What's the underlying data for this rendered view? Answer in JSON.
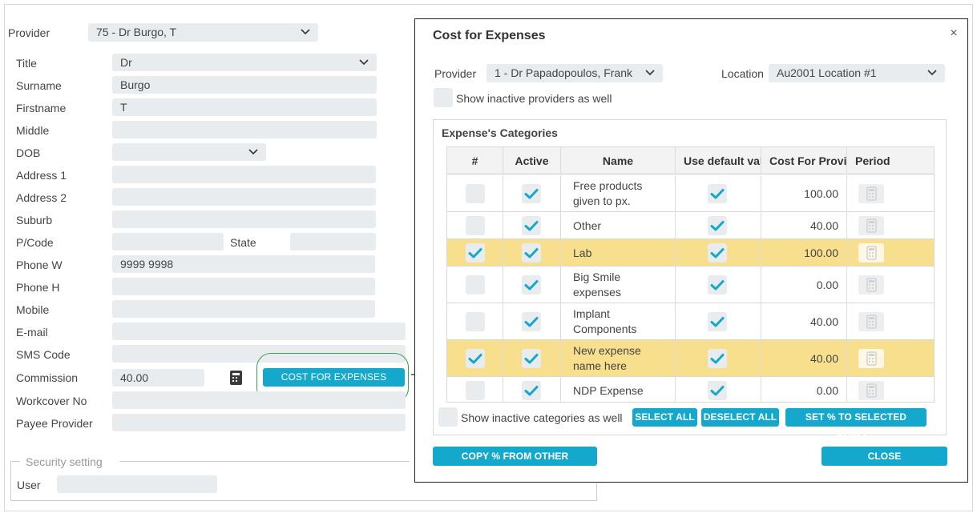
{
  "left_form": {
    "provider": {
      "label": "Provider",
      "value": "75 - Dr Burgo, T"
    },
    "title": {
      "label": "Title",
      "value": "Dr"
    },
    "surname": {
      "label": "Surname",
      "value": "Burgo"
    },
    "firstname": {
      "label": "Firstname",
      "value": "T"
    },
    "middle": {
      "label": "Middle",
      "value": ""
    },
    "dob": {
      "label": "DOB",
      "value": ""
    },
    "address1": {
      "label": "Address 1",
      "value": ""
    },
    "address2": {
      "label": "Address 2",
      "value": ""
    },
    "suburb": {
      "label": "Suburb",
      "value": ""
    },
    "pcode": {
      "label": "P/Code",
      "value": ""
    },
    "state": {
      "label": "State",
      "value": ""
    },
    "phone_w": {
      "label": "Phone W",
      "value": "9999 9998"
    },
    "phone_h": {
      "label": "Phone H",
      "value": ""
    },
    "mobile": {
      "label": "Mobile",
      "value": ""
    },
    "email": {
      "label": "E-mail",
      "value": ""
    },
    "sms_code": {
      "label": "SMS Code",
      "value": ""
    },
    "commission": {
      "label": "Commission",
      "value": "40.00"
    },
    "cost_button": "COST FOR EXPENSES",
    "workcover": {
      "label": "Workcover No",
      "value": ""
    },
    "payee": {
      "label": "Payee Provider",
      "value": ""
    },
    "security_legend": "Security setting",
    "user": {
      "label": "User",
      "value": ""
    }
  },
  "dialog": {
    "title": "Cost for Expenses",
    "close": "×",
    "provider": {
      "label": "Provider",
      "value": "1 - Dr Papadopoulos, Frank"
    },
    "location": {
      "label": "Location",
      "value": "Au2001 Location #1"
    },
    "show_inactive_providers": "Show inactive providers as well",
    "categories_title": "Expense's Categories",
    "columns": [
      "#",
      "Active",
      "Name",
      "Use default value",
      "Cost For Provider",
      "Period"
    ],
    "rows": [
      {
        "selected": false,
        "active": true,
        "name": [
          "Free products",
          "given to px."
        ],
        "use_default": true,
        "cost": "100.00",
        "highlight": false
      },
      {
        "selected": false,
        "active": true,
        "name": [
          "Other"
        ],
        "use_default": true,
        "cost": "40.00",
        "highlight": false
      },
      {
        "selected": true,
        "active": true,
        "name": [
          "Lab"
        ],
        "use_default": true,
        "cost": "100.00",
        "highlight": true
      },
      {
        "selected": false,
        "active": true,
        "name": [
          "Big Smile",
          "expenses"
        ],
        "use_default": true,
        "cost": "0.00",
        "highlight": false
      },
      {
        "selected": false,
        "active": true,
        "name": [
          "Implant",
          "Components"
        ],
        "use_default": true,
        "cost": "40.00",
        "highlight": false
      },
      {
        "selected": true,
        "active": true,
        "name": [
          "New expense",
          "name here"
        ],
        "use_default": true,
        "cost": "40.00",
        "highlight": true
      },
      {
        "selected": false,
        "active": true,
        "name": [
          "NDP Expense"
        ],
        "use_default": true,
        "cost": "0.00",
        "highlight": false
      }
    ],
    "show_inactive_categories": "Show inactive categories as well",
    "select_all": "SELECT ALL",
    "deselect_all": "DESELECT ALL",
    "set_percent": "SET % TO SELECTED ROWS...",
    "copy_percent": "COPY % FROM OTHER PROVIDER...",
    "close_button": "CLOSE"
  },
  "colors": {
    "accent": "#14a9cc",
    "highlight_row": "#f8df8e",
    "annotation": "#3aa24a",
    "field_bg": "#e9ecef"
  }
}
